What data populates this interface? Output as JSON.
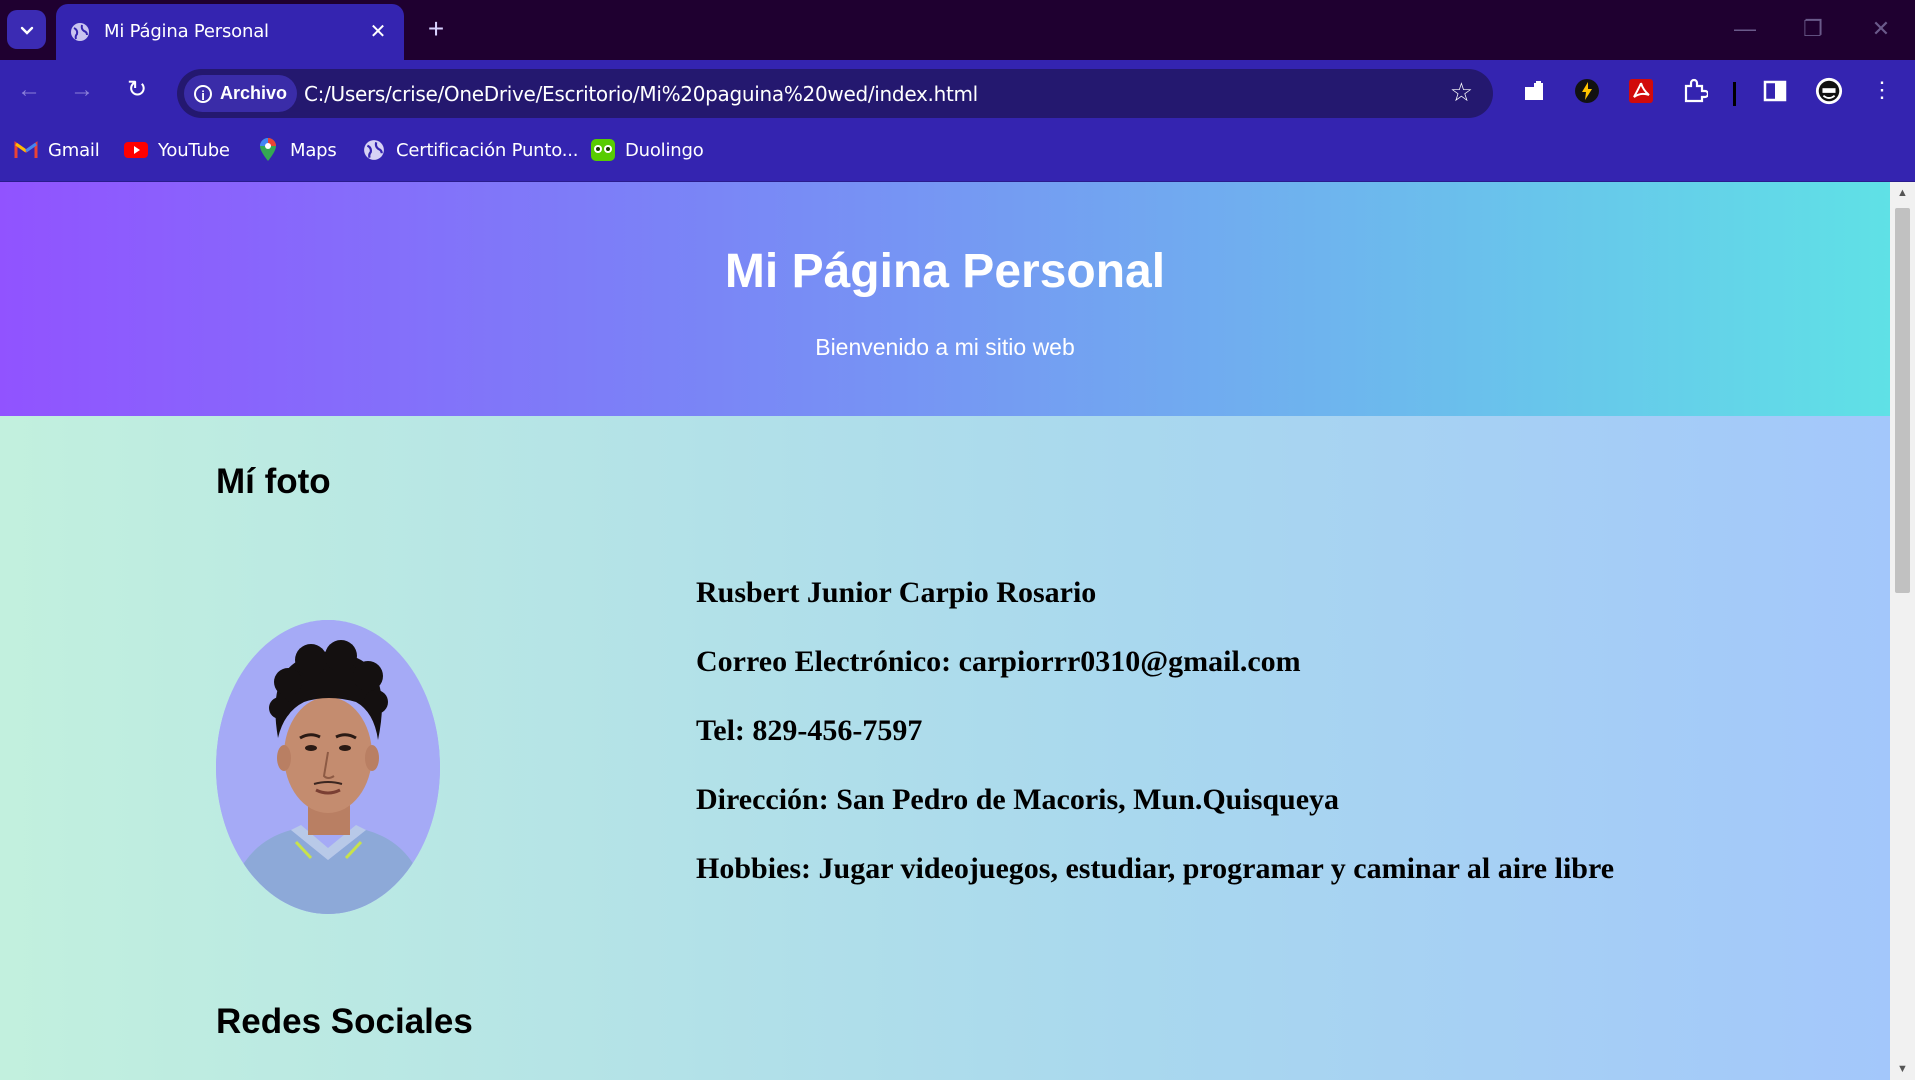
{
  "browser": {
    "tab_title": "Mi Página Personal",
    "chip_label": "Archivo",
    "url": "C:/Users/crise/OneDrive/Escritorio/Mi%20paguina%20wed/index.html",
    "bookmarks": [
      {
        "label": "Gmail",
        "icon": "gmail-icon"
      },
      {
        "label": "YouTube",
        "icon": "youtube-icon"
      },
      {
        "label": "Maps",
        "icon": "maps-icon"
      },
      {
        "label": "Certificación Punto...",
        "icon": "globe-icon"
      },
      {
        "label": "Duolingo",
        "icon": "duolingo-icon"
      }
    ]
  },
  "page": {
    "title": "Mi Página Personal",
    "subtitle": "Bienvenido a mi sitio web",
    "photo_heading": "Mí foto",
    "info": {
      "name": "Rusbert Junior Carpio Rosario",
      "email": "Correo Electrónico: carpiorrr0310@gmail.com",
      "phone": "Tel: 829-456-7597",
      "address": "Dirección: San Pedro de Macoris, Mun.Quisqueya",
      "hobbies": "Hobbies: Jugar videojuegos, estudiar, programar y caminar al aire libre"
    },
    "social_heading": "Redes Sociales"
  },
  "colors": {
    "chrome_bg": "#3424b0",
    "tabstrip_bg": "#1f0030",
    "hero_gradient": [
      "#9153ff",
      "#5fe1e6"
    ],
    "content_gradient": [
      "#c2f0de",
      "#a3c7fb"
    ]
  }
}
